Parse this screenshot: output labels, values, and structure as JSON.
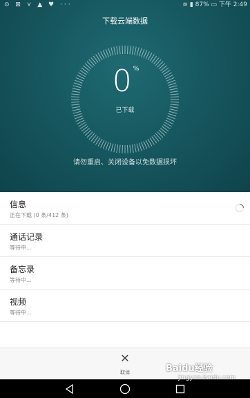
{
  "status_bar": {
    "left_icons": "⊙ ⊠ ⋎ ▲ ♥ ···",
    "battery": "87%",
    "time": "下午 2:49"
  },
  "hero": {
    "title": "下载云端数据",
    "percent": "0",
    "percent_sign": "%",
    "progress_fraction": 0,
    "downloaded_label": "已下载",
    "warning": "请勿重启、关闭设备以免数据损坏"
  },
  "items": [
    {
      "title": "信息",
      "status": "正在下载 (0 条/412 条)"
    },
    {
      "title": "通话记录",
      "status": "等待中..."
    },
    {
      "title": "备忘录",
      "status": "等待中..."
    },
    {
      "title": "视频",
      "status": "等待中..."
    }
  ],
  "bottom": {
    "cancel_label": "取消",
    "cancel_icon": "close-icon"
  },
  "nav": {
    "back_icon": "back-triangle-icon",
    "home_icon": "home-circle-icon",
    "recent_icon": "recent-square-icon"
  },
  "watermark": {
    "brand": "Baidu经验",
    "url": "jingyan.baidu.com"
  },
  "colors": {
    "hero_bg": "#175860",
    "hero_text": "#ffffff"
  }
}
